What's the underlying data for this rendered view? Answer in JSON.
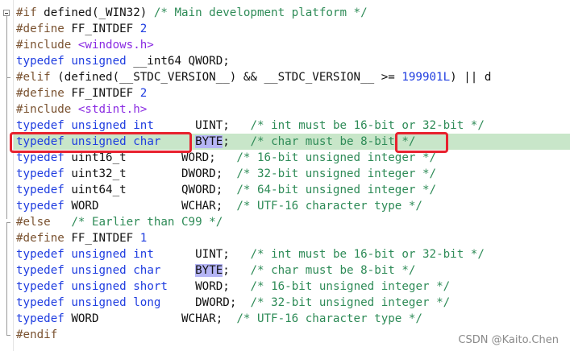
{
  "code_lines": [
    {
      "tokens": [
        {
          "t": "#if",
          "c": "pp"
        },
        {
          "t": " defined(_WIN32) ",
          "c": "tok"
        },
        {
          "t": "/* Main development platform */",
          "c": "cm"
        }
      ]
    },
    {
      "tokens": [
        {
          "t": "#define",
          "c": "pp"
        },
        {
          "t": " FF_INTDEF ",
          "c": "tok"
        },
        {
          "t": "2",
          "c": "num"
        }
      ]
    },
    {
      "tokens": [
        {
          "t": "#include",
          "c": "pp"
        },
        {
          "t": " ",
          "c": "tok"
        },
        {
          "t": "<windows.h>",
          "c": "str"
        }
      ]
    },
    {
      "tokens": [
        {
          "t": "typedef",
          "c": "kw"
        },
        {
          "t": " ",
          "c": "tok"
        },
        {
          "t": "unsigned",
          "c": "kw"
        },
        {
          "t": " __int64 QWORD;",
          "c": "tok"
        }
      ]
    },
    {
      "tokens": [
        {
          "t": "#elif",
          "c": "pp"
        },
        {
          "t": " (defined(__STDC_VERSION__) && __STDC_VERSION__ >= ",
          "c": "tok"
        },
        {
          "t": "199901L",
          "c": "num"
        },
        {
          "t": ") || d",
          "c": "tok"
        }
      ]
    },
    {
      "tokens": [
        {
          "t": "#define",
          "c": "pp"
        },
        {
          "t": " FF_INTDEF ",
          "c": "tok"
        },
        {
          "t": "2",
          "c": "num"
        }
      ]
    },
    {
      "tokens": [
        {
          "t": "#include",
          "c": "pp"
        },
        {
          "t": " ",
          "c": "tok"
        },
        {
          "t": "<stdint.h>",
          "c": "str"
        }
      ]
    },
    {
      "tokens": [
        {
          "t": "typedef",
          "c": "kw"
        },
        {
          "t": " ",
          "c": "tok"
        },
        {
          "t": "unsigned",
          "c": "kw"
        },
        {
          "t": " ",
          "c": "tok"
        },
        {
          "t": "int",
          "c": "kw"
        },
        {
          "t": "      UINT;   ",
          "c": "tok"
        },
        {
          "t": "/* int must be 16-bit or 32-bit */",
          "c": "cm"
        }
      ]
    },
    {
      "tokens": [
        {
          "t": "typedef",
          "c": "kw"
        },
        {
          "t": " ",
          "c": "tok"
        },
        {
          "t": "unsigned",
          "c": "kw"
        },
        {
          "t": " ",
          "c": "tok"
        },
        {
          "t": "char",
          "c": "kw"
        },
        {
          "t": "     ",
          "c": "tok"
        },
        {
          "t": "BYTE",
          "c": "tok",
          "sel": true
        },
        {
          "t": ";   ",
          "c": "tok"
        },
        {
          "t": "/* char must be 8-bit */",
          "c": "cm"
        }
      ]
    },
    {
      "tokens": [
        {
          "t": "typedef",
          "c": "kw"
        },
        {
          "t": " uint16_t        WORD;   ",
          "c": "tok"
        },
        {
          "t": "/* 16-bit unsigned integer */",
          "c": "cm"
        }
      ]
    },
    {
      "tokens": [
        {
          "t": "typedef",
          "c": "kw"
        },
        {
          "t": " uint32_t        DWORD;  ",
          "c": "tok"
        },
        {
          "t": "/* 32-bit unsigned integer */",
          "c": "cm"
        }
      ]
    },
    {
      "tokens": [
        {
          "t": "typedef",
          "c": "kw"
        },
        {
          "t": " uint64_t        QWORD;  ",
          "c": "tok"
        },
        {
          "t": "/* 64-bit unsigned integer */",
          "c": "cm"
        }
      ]
    },
    {
      "tokens": [
        {
          "t": "typedef",
          "c": "kw"
        },
        {
          "t": " WORD            WCHAR;  ",
          "c": "tok"
        },
        {
          "t": "/* UTF-16 character type */",
          "c": "cm"
        }
      ]
    },
    {
      "tokens": [
        {
          "t": "#else",
          "c": "pp"
        },
        {
          "t": "   ",
          "c": "tok"
        },
        {
          "t": "/* Earlier than C99 */",
          "c": "cm"
        }
      ]
    },
    {
      "tokens": [
        {
          "t": "#define",
          "c": "pp"
        },
        {
          "t": " FF_INTDEF ",
          "c": "tok"
        },
        {
          "t": "1",
          "c": "num"
        }
      ]
    },
    {
      "tokens": [
        {
          "t": "typedef",
          "c": "kw"
        },
        {
          "t": " ",
          "c": "tok"
        },
        {
          "t": "unsigned",
          "c": "kw"
        },
        {
          "t": " ",
          "c": "tok"
        },
        {
          "t": "int",
          "c": "kw"
        },
        {
          "t": "      UINT;   ",
          "c": "tok"
        },
        {
          "t": "/* int must be 16-bit or 32-bit */",
          "c": "cm"
        }
      ]
    },
    {
      "tokens": [
        {
          "t": "typedef",
          "c": "kw"
        },
        {
          "t": " ",
          "c": "tok"
        },
        {
          "t": "unsigned",
          "c": "kw"
        },
        {
          "t": " ",
          "c": "tok"
        },
        {
          "t": "char",
          "c": "kw"
        },
        {
          "t": "     ",
          "c": "tok"
        },
        {
          "t": "BYTE",
          "c": "tok",
          "sel": true
        },
        {
          "t": ";   ",
          "c": "tok"
        },
        {
          "t": "/* char must be 8-bit */",
          "c": "cm"
        }
      ]
    },
    {
      "tokens": [
        {
          "t": "typedef",
          "c": "kw"
        },
        {
          "t": " ",
          "c": "tok"
        },
        {
          "t": "unsigned",
          "c": "kw"
        },
        {
          "t": " ",
          "c": "tok"
        },
        {
          "t": "short",
          "c": "kw"
        },
        {
          "t": "    WORD;   ",
          "c": "tok"
        },
        {
          "t": "/* 16-bit unsigned integer */",
          "c": "cm"
        }
      ]
    },
    {
      "tokens": [
        {
          "t": "typedef",
          "c": "kw"
        },
        {
          "t": " ",
          "c": "tok"
        },
        {
          "t": "unsigned",
          "c": "kw"
        },
        {
          "t": " ",
          "c": "tok"
        },
        {
          "t": "long",
          "c": "kw"
        },
        {
          "t": "     DWORD;  ",
          "c": "tok"
        },
        {
          "t": "/* 32-bit unsigned integer */",
          "c": "cm"
        }
      ]
    },
    {
      "tokens": [
        {
          "t": "typedef",
          "c": "kw"
        },
        {
          "t": " WORD            WCHAR;  ",
          "c": "tok"
        },
        {
          "t": "/* UTF-16 character type */",
          "c": "cm"
        }
      ]
    },
    {
      "tokens": [
        {
          "t": "#endif",
          "c": "pp"
        }
      ]
    }
  ],
  "highlighted_line": 9,
  "colors": {
    "keyword": "#1f3de0",
    "preprocessor": "#7a5230",
    "string": "#8a2be2",
    "comment": "#2e8b57",
    "line_highlight": "#c8e6c9",
    "selection": "#b5b5f5",
    "annotation_box": "#e8212e"
  },
  "watermark": "CSDN @Kaito.Chen"
}
